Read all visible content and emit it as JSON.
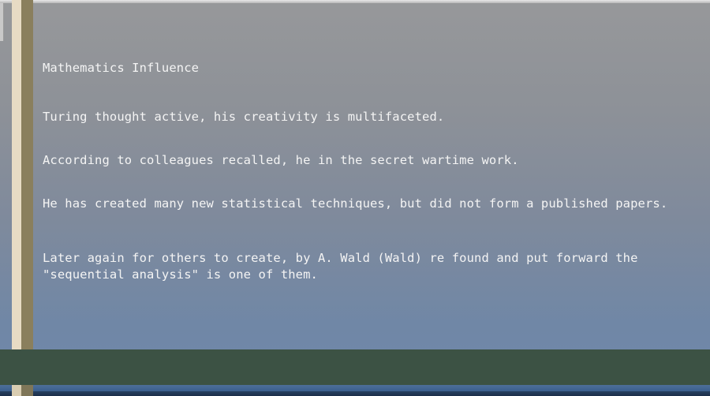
{
  "document": {
    "title": "Mathematics Influence",
    "paragraphs": [
      "Turing thought active, his creativity is multifaceted.",
      "According to colleagues recalled, he in the secret wartime work.",
      "He has created many new statistical techniques, but did not form a published papers.",
      "Later again for others to create, by A. Wald (Wald) re found and put forward the \"sequential analysis\" is one of them."
    ]
  }
}
